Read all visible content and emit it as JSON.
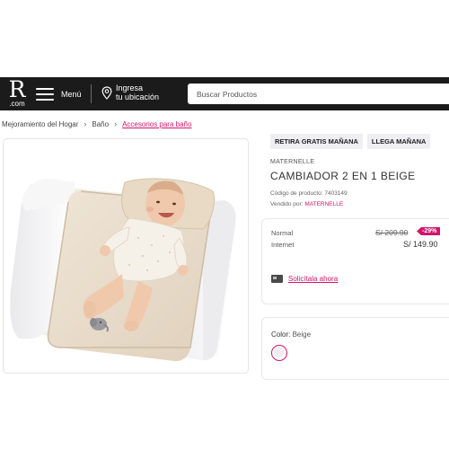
{
  "header": {
    "logo_letter": "R",
    "logo_domain": ".com",
    "menu_label": "Menú",
    "location_line1": "Ingresa",
    "location_line2": "tu ubicación",
    "search_placeholder": "Buscar Productos"
  },
  "breadcrumb": {
    "items": [
      "Mejoramiento del Hogar",
      "Baño",
      "Accesorios para baño"
    ]
  },
  "product": {
    "badges": [
      "RETIRA GRATIS MAÑANA",
      "LLEGA MAÑANA"
    ],
    "brand": "MATERNELLE",
    "title": "CAMBIADOR 2 EN 1 BEIGE",
    "code_text": "Código de producto: 7403149",
    "seller_prefix": "Vendido por:",
    "seller_name": "MATERNELLE",
    "image_icon": "baby-changing-mat-photo"
  },
  "pricing": {
    "normal_label": "Normal",
    "normal_price": "S/ 209.90",
    "discount": "-29%",
    "internet_label": "Internet",
    "internet_price": "S/ 149.90",
    "card_icon": "credit-card-icon",
    "cta_label": "Solicítala ahora"
  },
  "color": {
    "label": "Color:",
    "value": "Beige",
    "swatch_color": "#f4ecef"
  },
  "colors": {
    "accent": "#d0166c",
    "header_bg": "#1b1b1b",
    "badge_bg": "#eeeef3"
  }
}
